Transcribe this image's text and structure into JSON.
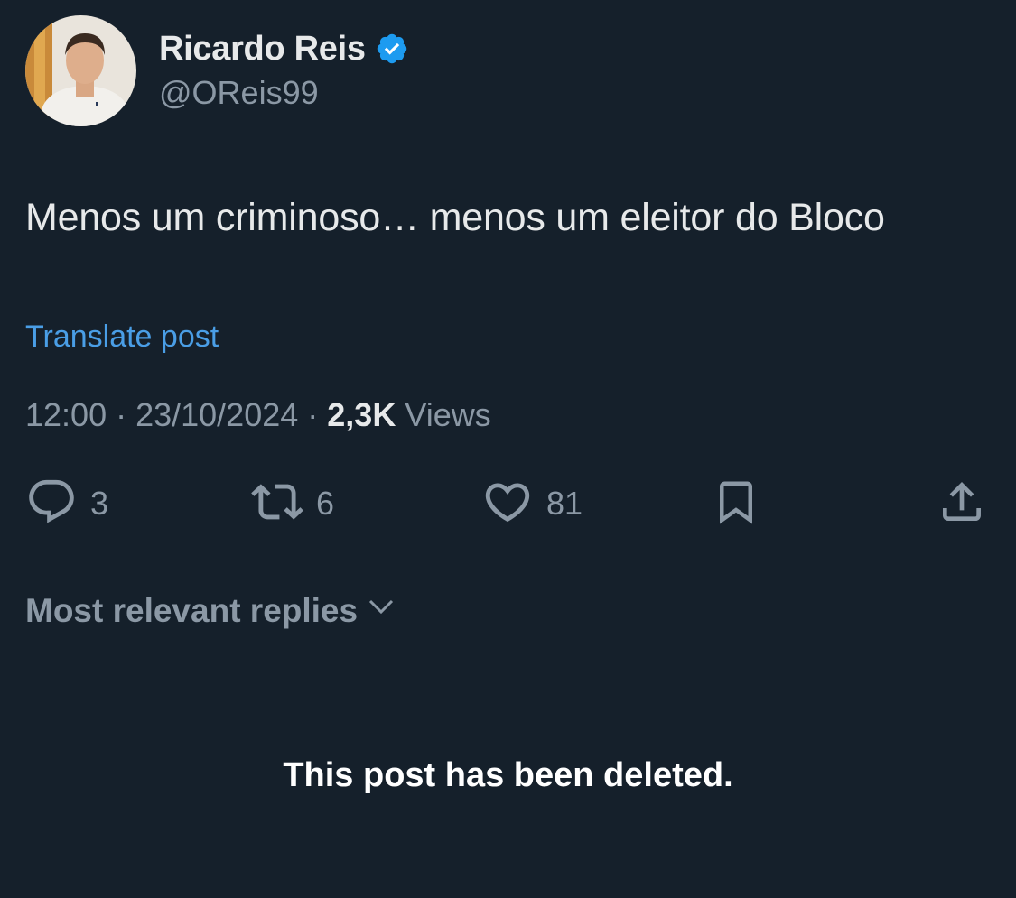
{
  "author": {
    "display_name": "Ricardo Reis",
    "handle": "@OReis99",
    "verified": true
  },
  "post": {
    "text": "Menos um criminoso… menos um eleitor do Bloco",
    "translate_label": "Translate post",
    "time": "12:00",
    "separator": " · ",
    "date": "23/10/2024",
    "views_count": "2,3K",
    "views_label": " Views"
  },
  "actions": {
    "reply_count": "3",
    "repost_count": "6",
    "like_count": "81",
    "icons": [
      "reply-icon",
      "repost-icon",
      "like-icon",
      "bookmark-icon",
      "share-icon"
    ]
  },
  "replies": {
    "sort_label": "Most relevant replies"
  },
  "deleted_notice": "This post has been deleted.",
  "colors": {
    "background": "#15202b",
    "primary_text": "#e7e9ea",
    "secondary_text": "#8b98a5",
    "link": "#4a9ee6",
    "verified": "#1d9bf0"
  }
}
